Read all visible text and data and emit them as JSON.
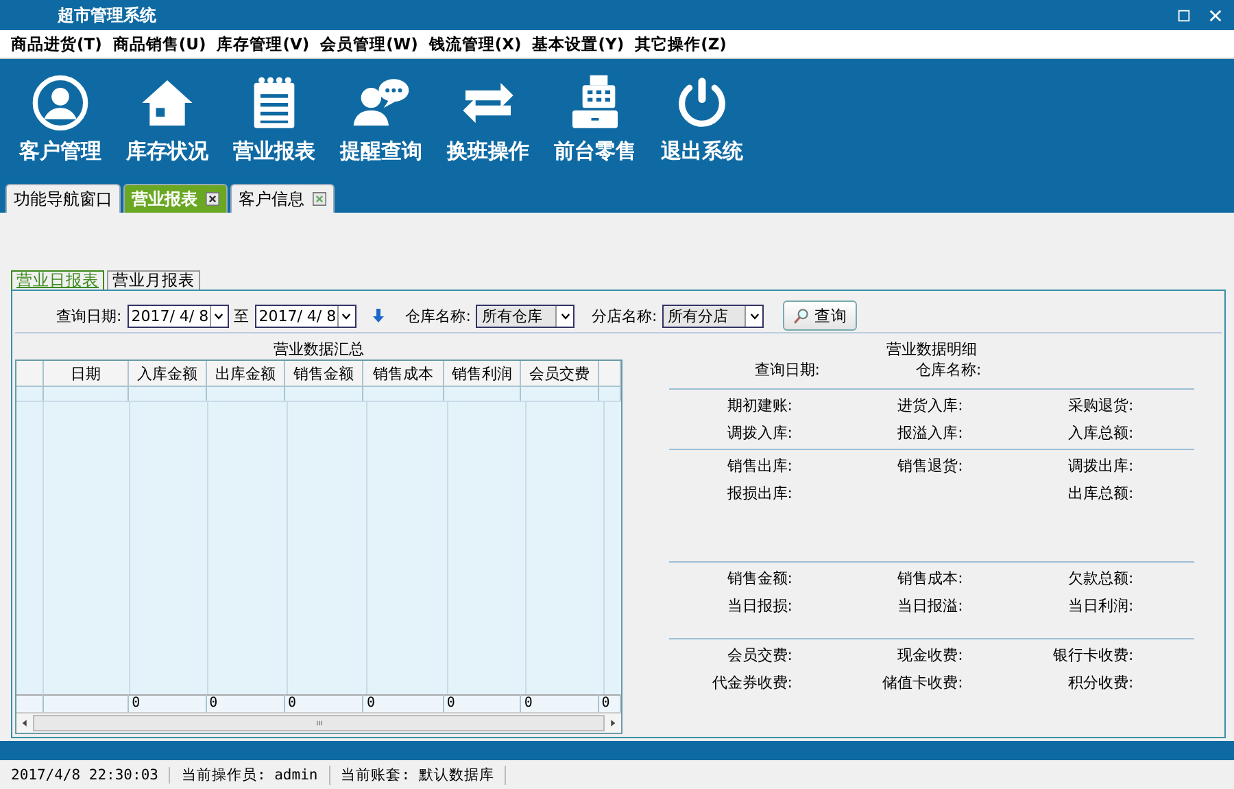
{
  "window": {
    "title": "超市管理系统"
  },
  "menu": [
    "商品进货(T)",
    "商品销售(U)",
    "库存管理(V)",
    "会员管理(W)",
    "钱流管理(X)",
    "基本设置(Y)",
    "其它操作(Z)"
  ],
  "toolbar": [
    {
      "label": "客户管理"
    },
    {
      "label": "库存状况"
    },
    {
      "label": "营业报表"
    },
    {
      "label": "提醒查询"
    },
    {
      "label": "换班操作"
    },
    {
      "label": "前台零售"
    },
    {
      "label": "退出系统"
    }
  ],
  "tabs": [
    {
      "label": "功能导航窗口",
      "selected": false,
      "kind": "fixed"
    },
    {
      "label": "营业报表",
      "selected": true,
      "kind": "closable"
    },
    {
      "label": "客户信息",
      "selected": false,
      "kind": "closable"
    }
  ],
  "subtabs": [
    {
      "label": "营业日报表",
      "selected": true
    },
    {
      "label": "营业月报表",
      "selected": false
    }
  ],
  "query": {
    "date_label": "查询日期:",
    "date_from": "2017/ 4/ 8",
    "to_label": "至",
    "date_to": "2017/ 4/ 8",
    "warehouse_label": "仓库名称:",
    "warehouse": "所有仓库",
    "branch_label": "分店名称:",
    "branch": "所有分店",
    "button": "查询"
  },
  "summary": {
    "title": "营业数据汇总",
    "columns": [
      "日期",
      "入库金额",
      "出库金额",
      "销售金额",
      "销售成本",
      "销售利润",
      "会员交费"
    ],
    "totals": [
      "0",
      "0",
      "0",
      "0",
      "0",
      "0",
      "0"
    ]
  },
  "detail": {
    "title": "营业数据明细",
    "header": [
      "查询日期:",
      "仓库名称:"
    ],
    "groups": [
      [
        [
          "期初建账:",
          "进货入库:",
          "采购退货:"
        ],
        [
          "调拨入库:",
          "报溢入库:",
          "入库总额:"
        ]
      ],
      [
        [
          "销售出库:",
          "销售退货:",
          "调拨出库:"
        ],
        [
          "报损出库:",
          "出库总额:"
        ]
      ],
      [
        [
          "销售金额:",
          "销售成本:",
          "欠款总额:"
        ],
        [
          "当日报损:",
          "当日报溢:",
          "当日利润:"
        ]
      ],
      [
        [
          "会员交费:",
          "现金收费:",
          "银行卡收费:"
        ],
        [
          "代金券收费:",
          "储值卡收费:",
          "积分收费:"
        ]
      ]
    ]
  },
  "status_bar": {
    "time": "2017/4/8 22:30:03",
    "operator": "当前操作员: admin",
    "account": "当前账套: 默认数据库"
  }
}
